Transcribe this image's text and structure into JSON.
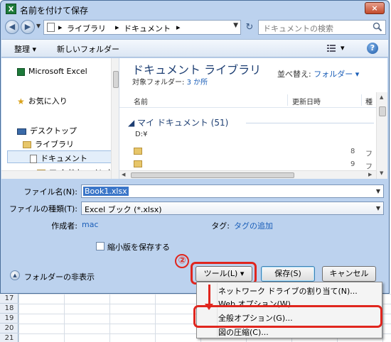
{
  "excel": {
    "row_numbers": [
      "17",
      "18",
      "19",
      "20",
      "21"
    ]
  },
  "window": {
    "title": "名前を付けて保存",
    "app_icon": "X",
    "close_label": "×"
  },
  "address": {
    "crumbs": [
      "ライブラリ",
      "ドキュメント"
    ],
    "search_placeholder": "ドキュメントの検索"
  },
  "toolbar": {
    "organize_label": "整理 ▾",
    "new_folder_label": "新しいフォルダー",
    "view_menu_arrow": "▾",
    "help_label": "?"
  },
  "navpane": {
    "items": [
      {
        "label": "Microsoft Excel",
        "icon": "excel-icon"
      },
      {
        "label": "お気に入り",
        "icon": "star-icon"
      },
      {
        "label": "デスクトップ",
        "icon": "desktop-icon"
      },
      {
        "label": "ライブラリ",
        "icon": "library-icon"
      },
      {
        "label": "ドキュメント",
        "icon": "documents-icon"
      },
      {
        "label": "マイ ドキュメント",
        "icon": "folder-icon"
      }
    ]
  },
  "content": {
    "library_title": "ドキュメント ライブラリ",
    "target_label": "対象フォルダー: ",
    "target_link": "3 か所",
    "arrange_label": "並べ替え: ",
    "arrange_value": "フォルダー ▾",
    "columns": [
      "名前",
      "更新日時",
      "種"
    ],
    "group_header": "◢ マイ ドキュメント (51)",
    "path": "D:¥",
    "rows": [
      {
        "size": "8",
        "type": "フ"
      },
      {
        "size": "9",
        "type": "フ"
      }
    ]
  },
  "form": {
    "filename_label": "ファイル名(N):",
    "filename_value": "Book1.xlsx",
    "filetype_label": "ファイルの種類(T):",
    "filetype_value": "Excel ブック (*.xlsx)",
    "author_label": "作成者:",
    "author_value": "mac",
    "tag_label": "タグ:",
    "tag_value": "タグの追加",
    "thumbnail_label": "縮小版を保存する"
  },
  "buttons": {
    "hide_folders": "フォルダーの非表示",
    "tools": "ツール(L)  ▾",
    "save": "保存(S)",
    "cancel": "キャンセル"
  },
  "annotation": {
    "step_number": "②"
  },
  "menu": {
    "items": [
      "ネットワーク ドライブの割り当て(N)...",
      "Web オプション(W)...",
      "全般オプション(G)...",
      "図の圧縮(C)..."
    ]
  },
  "colors": {
    "accent": "#3b76c8",
    "annotation": "#e0261e",
    "link": "#1a5eb8"
  }
}
